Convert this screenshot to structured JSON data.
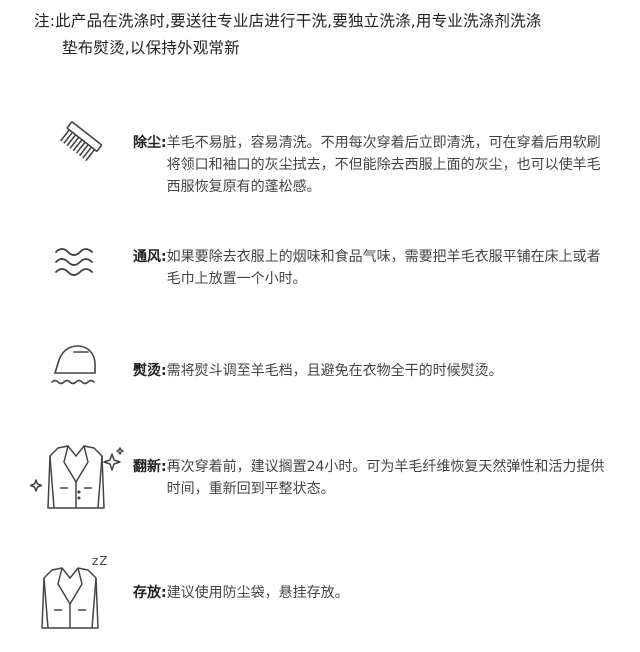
{
  "notice": {
    "line1": "注:此产品在洗涤时,要送往专业店进行干洗,要独立洗涤,用专业洗涤剂洗涤",
    "line2": "垫布熨烫,以保持外观常新"
  },
  "items": [
    {
      "icon": "comb-icon",
      "label": "除尘:",
      "text": "羊毛不易脏，容易清洗。不用每次穿着后立即清洗，可在穿着后用软刷将领口和袖口的灰尘拭去，不但能除去西服上面的灰尘，也可以使羊毛西服恢复原有的蓬松感。"
    },
    {
      "icon": "air-waves-icon",
      "label": "通风:",
      "text": "如果要除去衣服上的烟味和食品气味，需要把羊毛衣服平铺在床上或者毛巾上放置一个小时。"
    },
    {
      "icon": "iron-icon",
      "label": "熨烫:",
      "text": "需将熨斗调至羊毛档，且避免在衣物全干的时候熨烫。"
    },
    {
      "icon": "suit-sparkle-icon",
      "label": "翻新:",
      "text": "再次穿着前，建议搁置24小时。可为羊毛纤维恢复天然弹性和活力提供时间，重新回到平整状态。"
    },
    {
      "icon": "suit-sleep-icon",
      "label": "存放:",
      "text": "建议使用防尘袋，悬挂存放。"
    }
  ],
  "sleep_mark": "zZ"
}
